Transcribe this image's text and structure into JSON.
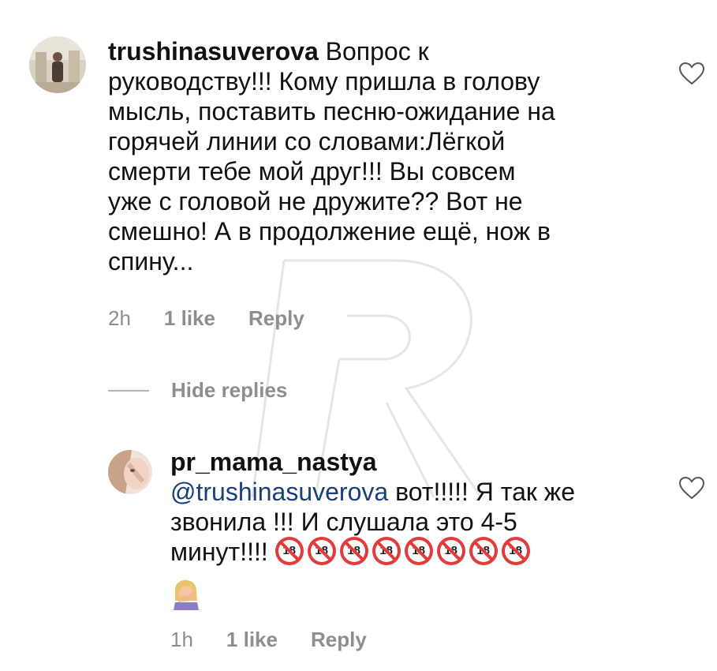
{
  "comments": [
    {
      "username": "trushinasuverova",
      "lines": [
        "Вопрос к",
        "руководству!!! Кому пришла в голову",
        "мысль, поставить песню-ожидание на",
        "горячей линии со словами:Лёгкой",
        "смерти тебе мой друг!!! Вы  совсем",
        "уже с головой не дружите?? Вот не",
        "смешно! А в продолжение ещё, нож в",
        "спину..."
      ],
      "time": "2h",
      "likes": "1 like",
      "reply": "Reply"
    }
  ],
  "hide_replies": "Hide replies",
  "reply_comment": {
    "username": "pr_mama_nastya",
    "mention": "@trushinasuverova",
    "line1_rest": " вот!!!!! Я так же",
    "line2": "звонила !!! И слушала это 4-5",
    "line3": "минут!!!! ",
    "emoji_no18": [
      "no-under-18-icon",
      "no-under-18-icon",
      "no-under-18-icon",
      "no-under-18-icon",
      "no-under-18-icon",
      "no-under-18-icon",
      "no-under-18-icon",
      "no-under-18-icon"
    ],
    "emoji_last": "facepalm-icon",
    "time": "1h",
    "likes": "1 like",
    "reply": "Reply"
  },
  "icons": {
    "like": "heart-outline-icon"
  }
}
